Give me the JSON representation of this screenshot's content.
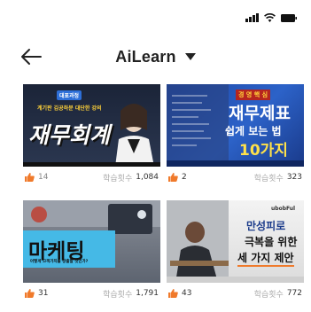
{
  "header": {
    "title": "AiLearn"
  },
  "colors": {
    "accent": "#f07a2b",
    "text": "#222222",
    "muted": "#aaaaaa"
  },
  "cards": [
    {
      "thumb": {
        "badge": "대표과정",
        "subtitle": "계기판 김공하분 대단한 강의",
        "main": "재무회계"
      },
      "likes": "14",
      "views_label": "학습횟수",
      "views": "1,084"
    },
    {
      "thumb": {
        "line1": "경 영 핵 심",
        "line2": "재무제표",
        "line3": "쉽게 보는 법",
        "line4": "10가지"
      },
      "likes": "2",
      "views_label": "학습횟수",
      "views": "323"
    },
    {
      "thumb": {
        "main": "마케팅",
        "sub": "어떻게 고객가치를 창출할 것인가?"
      },
      "likes": "31",
      "views_label": "학습횟수",
      "views": "1,791"
    },
    {
      "thumb": {
        "brand": "ubobFul",
        "line1": "만성피로",
        "line2": "극복을 위한",
        "line3": "세 가지 제안"
      },
      "likes": "43",
      "views_label": "학습횟수",
      "views": "772"
    }
  ]
}
